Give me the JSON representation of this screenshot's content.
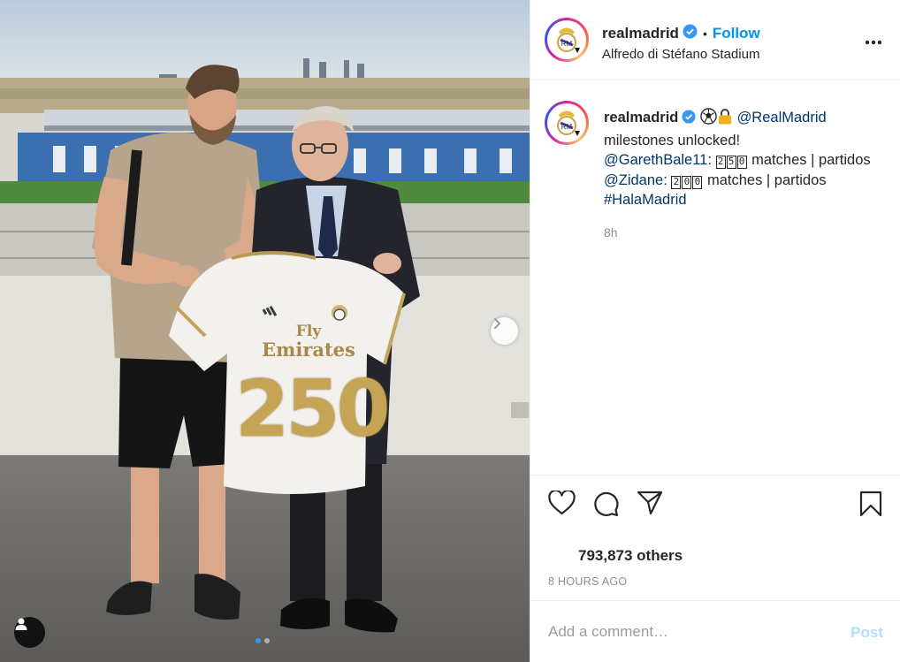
{
  "post": {
    "account": "realmadrid",
    "follow_label": "Follow",
    "separator": "•",
    "location": "Alfredo di Stéfano Stadium",
    "caption": {
      "username": "realmadrid",
      "mention_self": "@RealMadrid",
      "line2": "milestones unlocked!",
      "mention_bale": "@GarethBale11",
      "bale_suffix_a": ":",
      "bale_digits": [
        "2",
        "5",
        "0"
      ],
      "bale_text": "matches | partidos",
      "mention_zidane": "@Zidane",
      "zidane_suffix": ":",
      "zidane_digits": [
        "2",
        "0",
        "0"
      ],
      "zidane_text": "matches | partidos",
      "hashtag": "#HalaMadrid"
    },
    "caption_age": "8h",
    "likes": "793,873 others",
    "timestamp": "8 HOURS AGO",
    "comment_placeholder": "Add a comment…",
    "post_button": "Post"
  },
  "photo": {
    "jersey_sponsor_line1": "Fly",
    "jersey_sponsor_line2": "Emirates",
    "jersey_number": "250",
    "carousel": {
      "total": 2,
      "current": 1
    }
  },
  "colors": {
    "follow_blue": "#0095f6",
    "link_navy": "#00376b",
    "verified_blue": "#3897f0",
    "muted_gray": "#8e8e8e",
    "post_disabled": "#b2dffc"
  },
  "icons": [
    "verified-badge-icon",
    "more-options-icon",
    "heart-icon",
    "comment-icon",
    "share-icon",
    "bookmark-icon",
    "chevron-right-icon",
    "user-tag-icon",
    "soccer-ball-icon",
    "lock-icon",
    "crest-icon"
  ]
}
